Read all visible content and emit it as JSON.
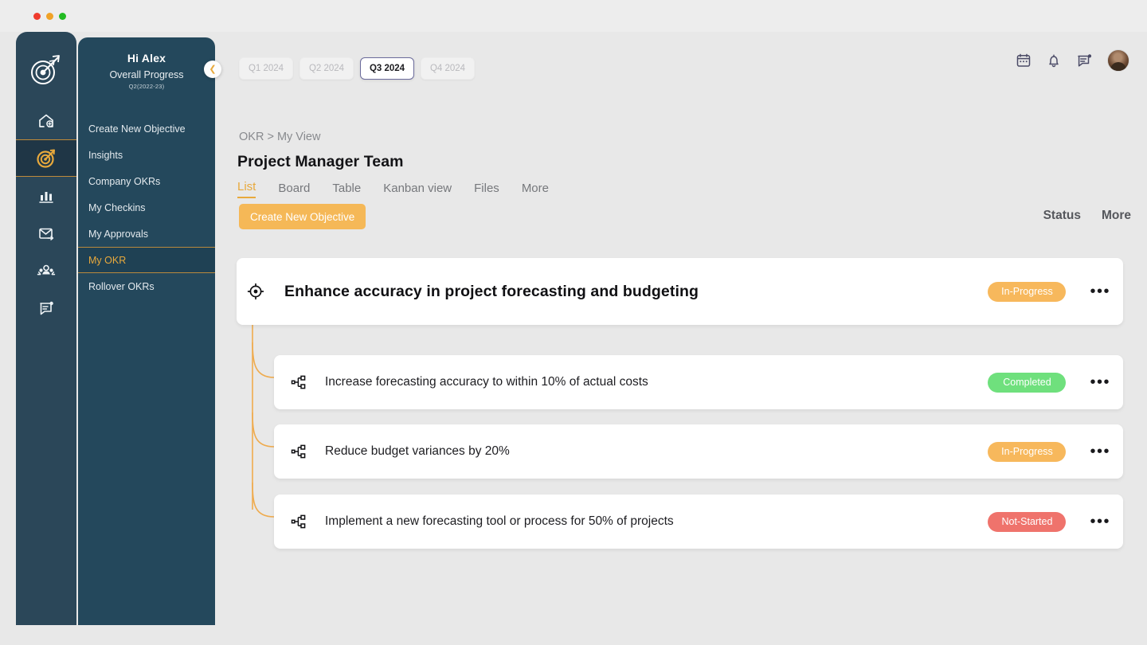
{
  "window": {
    "lights": [
      "red",
      "amber",
      "green"
    ]
  },
  "rail": {
    "logo_icon": "target-arrow-logo",
    "items": [
      {
        "icon": "home-add-icon",
        "name": "rail-item-home",
        "active": false
      },
      {
        "icon": "target-icon",
        "name": "rail-item-okr",
        "active": true
      },
      {
        "icon": "bar-chart-icon",
        "name": "rail-item-analytics",
        "active": false
      },
      {
        "icon": "mail-send-icon",
        "name": "rail-item-mail",
        "active": false
      },
      {
        "icon": "people-icon",
        "name": "rail-item-teams",
        "active": false
      },
      {
        "icon": "feedback-icon",
        "name": "rail-item-feedback",
        "active": false
      }
    ]
  },
  "sidebar": {
    "greeting": "Hi Alex",
    "progress_label": "Overall Progress",
    "quarter_label": "Q2(2022-23)",
    "collapse_icon": "chevron-left-icon",
    "items": [
      {
        "label": "Create New Objective",
        "active": false
      },
      {
        "label": "Insights",
        "active": false
      },
      {
        "label": "Company OKRs",
        "active": false
      },
      {
        "label": "My  Checkins",
        "active": false
      },
      {
        "label": "My Approvals",
        "active": false
      },
      {
        "label": "My OKR",
        "active": true
      },
      {
        "label": "Rollover OKRs",
        "active": false
      }
    ]
  },
  "topbar": {
    "icons": [
      {
        "name": "calendar-icon",
        "label": "calendar-icon"
      },
      {
        "name": "notifications-bell-icon",
        "label": "bell-icon"
      },
      {
        "name": "messages-icon",
        "label": "message-icon"
      }
    ],
    "avatar_name": "user-avatar"
  },
  "quarter_tabs": [
    {
      "label": "Q1 2024",
      "active": false
    },
    {
      "label": "Q2 2024",
      "active": false
    },
    {
      "label": "Q3 2024",
      "active": true
    },
    {
      "label": "Q4 2024",
      "active": false
    }
  ],
  "breadcrumb": "OKR > My View",
  "page_title": "Project Manager Team",
  "view_tabs": [
    {
      "label": "List",
      "active": true
    },
    {
      "label": "Board",
      "active": false
    },
    {
      "label": "Table",
      "active": false
    },
    {
      "label": "Kanban view",
      "active": false
    },
    {
      "label": "Files",
      "active": false
    },
    {
      "label": "More",
      "active": false
    }
  ],
  "create_button_label": "Create New Objective",
  "column_headers": [
    {
      "label": "Status"
    },
    {
      "label": "More"
    }
  ],
  "objective": {
    "icon": "objective-target-icon",
    "title": "Enhance accuracy in project forecasting and budgeting",
    "status": "In-Progress",
    "status_color": "#f7b85c",
    "more_icon": "more-options-icon"
  },
  "key_results": [
    {
      "icon": "key-result-node-icon",
      "title": "Increase forecasting accuracy to within 10% of actual costs",
      "status": "Completed",
      "status_color": "#6fe07d",
      "more_icon": "more-options-icon"
    },
    {
      "icon": "key-result-node-icon",
      "title": "Reduce budget variances by 20%",
      "status": "In-Progress",
      "status_color": "#f7b85c",
      "more_icon": "more-options-icon"
    },
    {
      "icon": "key-result-node-icon",
      "title": "Implement a new forecasting tool or process for 50% of projects",
      "status": "Not-Started",
      "status_color": "#ef736c",
      "more_icon": "more-options-icon"
    }
  ],
  "theme": {
    "accent": "#e8a93c",
    "sidebar_bg": "#24485c",
    "rail_bg": "#2b4759",
    "canvas_bg": "#e8e8e8",
    "connector": "#efab4e"
  }
}
